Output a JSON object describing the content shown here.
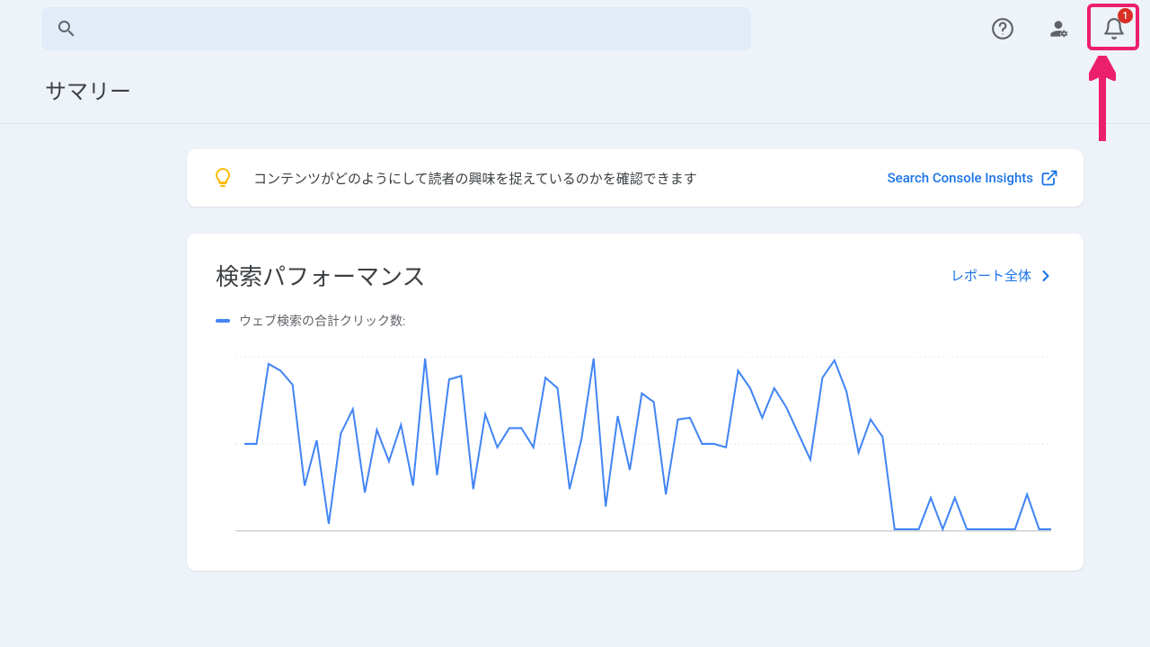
{
  "header": {
    "search_placeholder": "",
    "notification_count": "1"
  },
  "page": {
    "title": "サマリー"
  },
  "insights_card": {
    "message": "コンテンツがどのようにして読者の興味を捉えているのかを確認できます",
    "link_label": "Search Console Insights"
  },
  "performance_card": {
    "title": "検索パフォーマンス",
    "full_report_label": "レポート全体",
    "legend_label": "ウェブ検索の合計クリック数:"
  },
  "chart_data": {
    "type": "line",
    "title": "検索パフォーマンス",
    "ylabel": "ウェブ検索の合計クリック数",
    "xlabel": "",
    "ylim": [
      0,
      100
    ],
    "series": [
      {
        "name": "ウェブ検索の合計クリック数",
        "color": "#4285f4",
        "values": [
          50,
          50,
          96,
          92,
          84,
          26,
          52,
          4,
          56,
          70,
          22,
          58,
          40,
          61,
          26,
          99,
          32,
          87,
          89,
          24,
          67,
          48,
          59,
          59,
          48,
          88,
          82,
          24,
          53,
          99,
          14,
          66,
          35,
          79,
          74,
          21,
          64,
          65,
          50,
          50,
          48,
          92,
          82,
          65,
          82,
          71,
          56,
          41,
          88,
          98,
          80,
          45,
          64,
          54,
          1,
          1,
          1,
          19,
          1,
          19,
          1,
          1,
          1,
          1,
          1,
          21,
          1,
          1
        ]
      }
    ]
  }
}
